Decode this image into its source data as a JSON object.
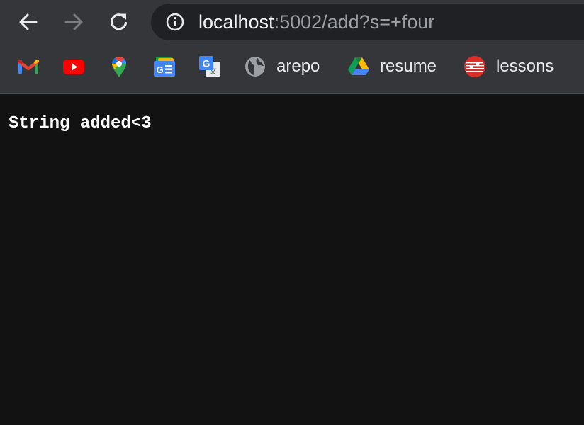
{
  "toolbar": {
    "back_icon": "arrow-left-icon",
    "forward_icon": "arrow-right-icon",
    "reload_icon": "reload-icon",
    "forward_enabled": false
  },
  "omnibox": {
    "info_icon": "info-icon",
    "url_host": "localhost",
    "url_rest": ":5002/add?s=+four"
  },
  "bookmarks": [
    {
      "icon": "gmail-icon",
      "label": ""
    },
    {
      "icon": "youtube-icon",
      "label": ""
    },
    {
      "icon": "google-maps-icon",
      "label": ""
    },
    {
      "icon": "google-news-icon",
      "label": ""
    },
    {
      "icon": "google-translate-icon",
      "label": ""
    },
    {
      "icon": "globe-icon",
      "label": "arepo"
    },
    {
      "icon": "google-drive-icon",
      "label": "resume"
    },
    {
      "icon": "music-staff-icon",
      "label": "lessons"
    }
  ],
  "page": {
    "text": "String added<3"
  },
  "colors": {
    "toolbar_bg": "#35363a",
    "omnibox_bg": "#202124",
    "page_bg": "#121212",
    "url_host": "#f1f3f4",
    "url_rest": "#9aa0a6"
  }
}
